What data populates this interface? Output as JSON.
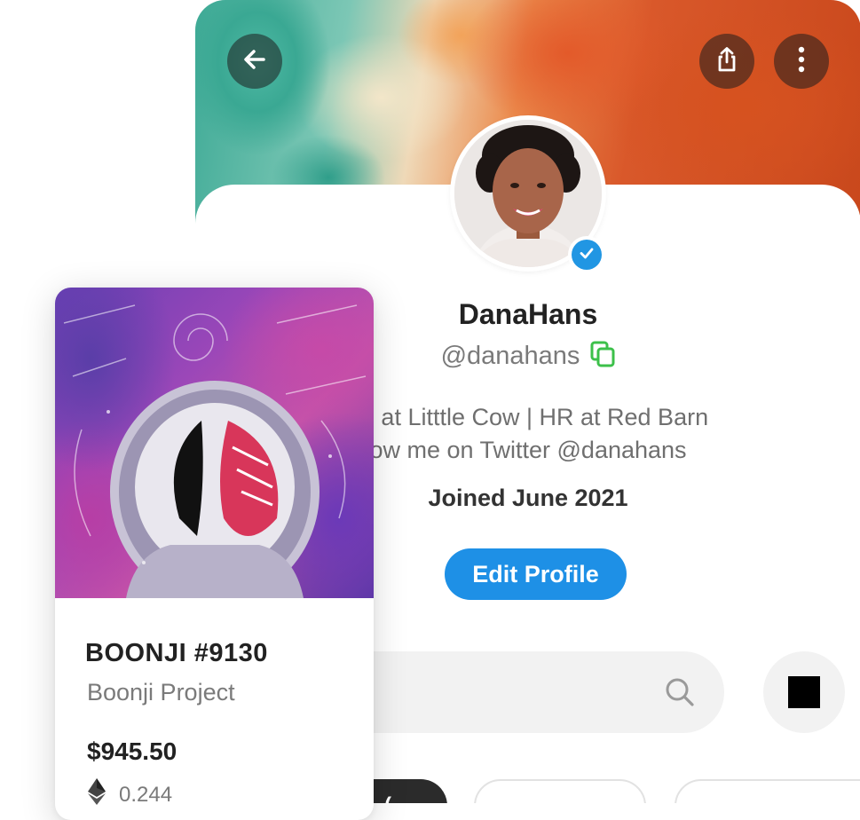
{
  "profile": {
    "display_name": "DanaHans",
    "handle": "@danahans",
    "bio_line_1": "ne at Litttle Cow | HR at Red Barn",
    "bio_line_2": "ow me on Twitter @danahans",
    "joined": "Joined June 2021",
    "edit_button": "Edit Profile",
    "verified": true
  },
  "header_buttons": {
    "back_icon": "arrow-left-icon",
    "share_icon": "share-icon",
    "more_icon": "more-vertical-icon"
  },
  "search": {
    "placeholder": "",
    "icon": "search-icon"
  },
  "filter_chips": [
    {
      "label": "(",
      "style": "dark"
    },
    {
      "label": "",
      "style": "outline"
    },
    {
      "label": "",
      "style": "outline"
    }
  ],
  "nft_card": {
    "title": "BOONJI #9130",
    "collection": "Boonji Project",
    "price": "$945.50",
    "eth_amount": "0.244",
    "eth_icon": "ethereum-icon"
  },
  "colors": {
    "accent_blue": "#1e90e6",
    "verified_blue": "#2196e3",
    "copy_green": "#3cc04a",
    "text_dark": "#222222",
    "text_muted": "#7a7a7a"
  }
}
